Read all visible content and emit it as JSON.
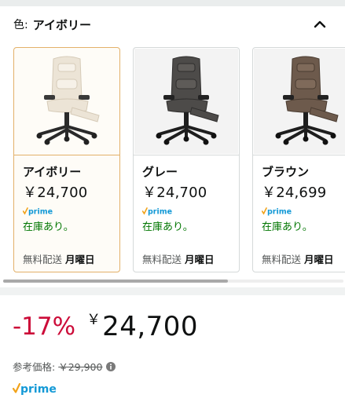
{
  "color_selector": {
    "label": "色:",
    "selected_value": "アイボリー"
  },
  "variants": [
    {
      "name": "アイボリー",
      "price": "￥24,700",
      "prime": "prime",
      "stock": "在庫あり。",
      "shipping": "無料配送",
      "ship_day": "月曜日",
      "selected": true
    },
    {
      "name": "グレー",
      "price": "￥24,700",
      "prime": "prime",
      "stock": "在庫あり。",
      "shipping": "無料配送",
      "ship_day": "月曜日",
      "selected": false
    },
    {
      "name": "ブラウン",
      "price": "￥24,699",
      "prime": "prime",
      "stock": "在庫あり。",
      "shipping": "無料配送",
      "ship_day": "月曜日",
      "selected": false
    }
  ],
  "pricing": {
    "discount": "-17%",
    "currency_symbol": "￥",
    "price": "24,700",
    "reference_label": "参考価格:",
    "reference_price": "￥29,900"
  },
  "prime_badge": "prime",
  "icons": {
    "collapse": "chevron-up-icon",
    "info": "info-icon",
    "prime_check": "check-icon"
  },
  "colors": {
    "discount_red": "#cc0c39",
    "stock_green": "#007600",
    "prime_blue": "#1399d6",
    "prime_check_orange": "#f2a31b",
    "selected_border": "#e3b16a"
  }
}
